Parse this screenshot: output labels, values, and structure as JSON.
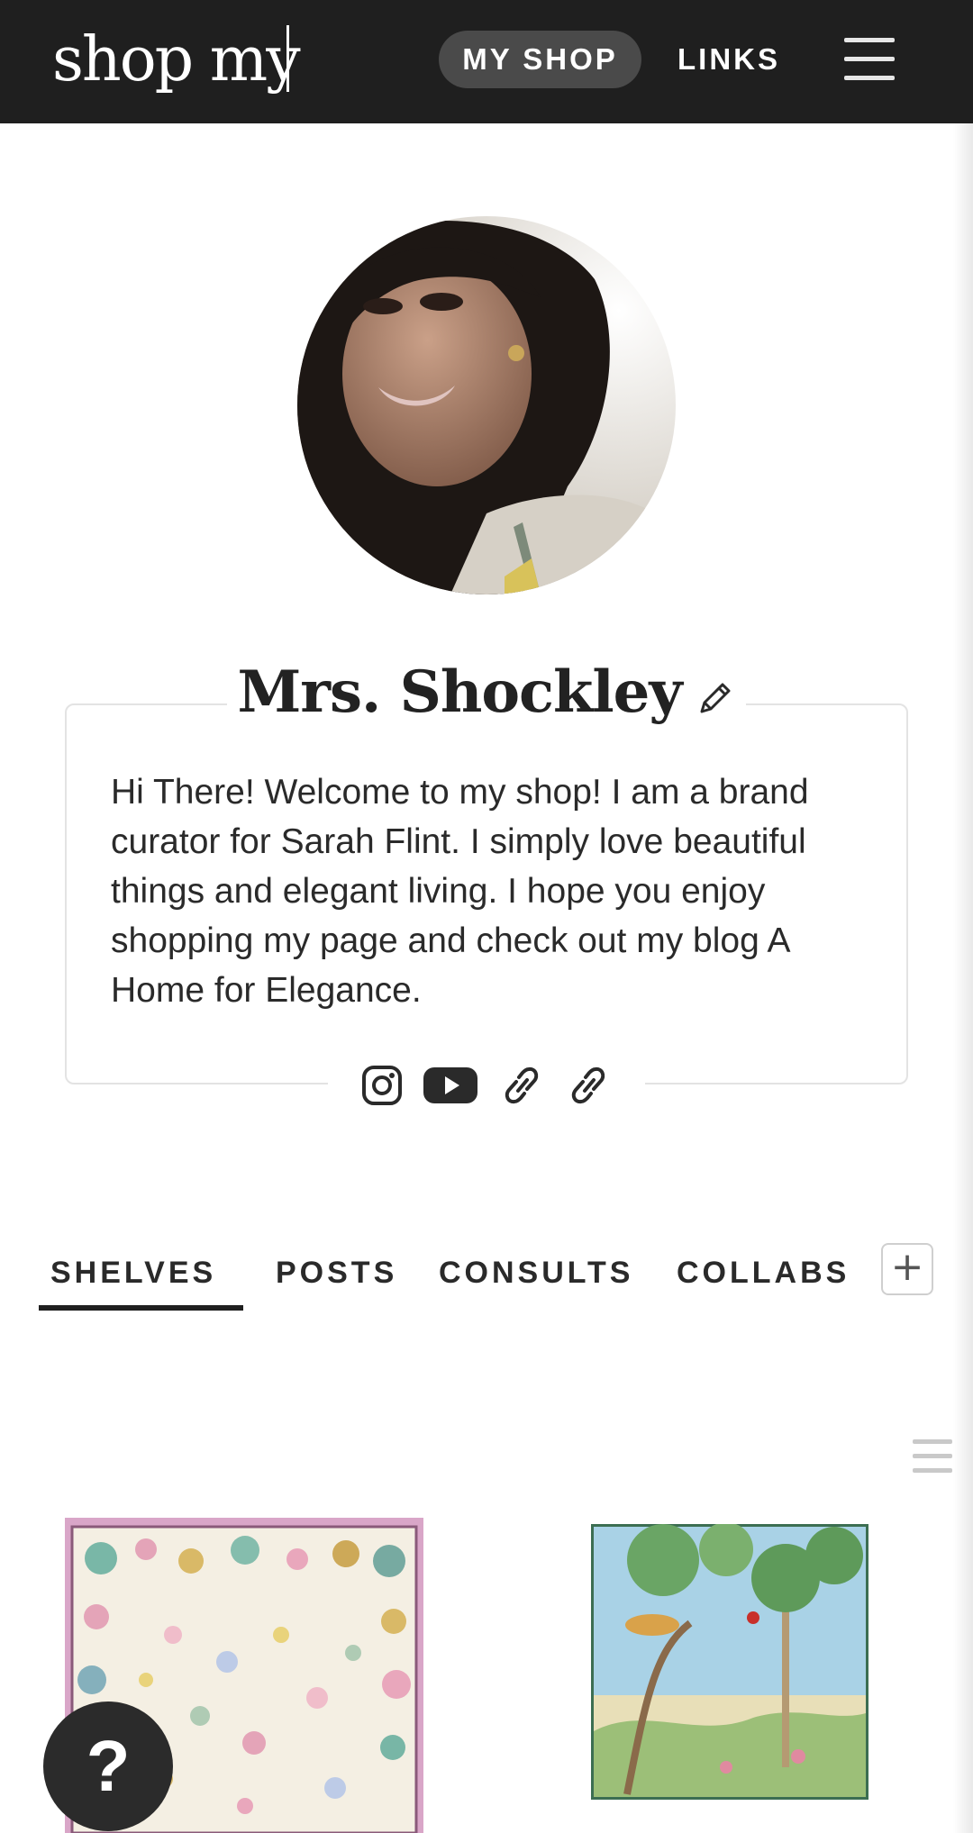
{
  "header": {
    "logo": "shop my",
    "nav": {
      "my_shop": "MY SHOP",
      "links": "LINKS"
    },
    "menu_icon": "hamburger-menu-icon"
  },
  "profile": {
    "name": "Mrs. Shockley",
    "edit_icon": "pencil-icon",
    "bio": "Hi There! Welcome to my shop! I am a brand curator for Sarah Flint. I simply love beautiful things and elegant living. I hope you enjoy shopping my page and check out my blog A Home for Elegance.",
    "socials": [
      "instagram-icon",
      "youtube-icon",
      "link-icon",
      "link-icon"
    ]
  },
  "tabs": [
    {
      "label": "SHELVES",
      "active": true
    },
    {
      "label": "POSTS",
      "active": false
    },
    {
      "label": "CONSULTS",
      "active": false
    },
    {
      "label": "COLLABS",
      "active": false
    }
  ],
  "add_tab_label": "+",
  "help_label": "?",
  "colors": {
    "header_bg": "#1f1f1f",
    "pill_bg": "#4a4a4a",
    "text": "#2a2a2a"
  }
}
